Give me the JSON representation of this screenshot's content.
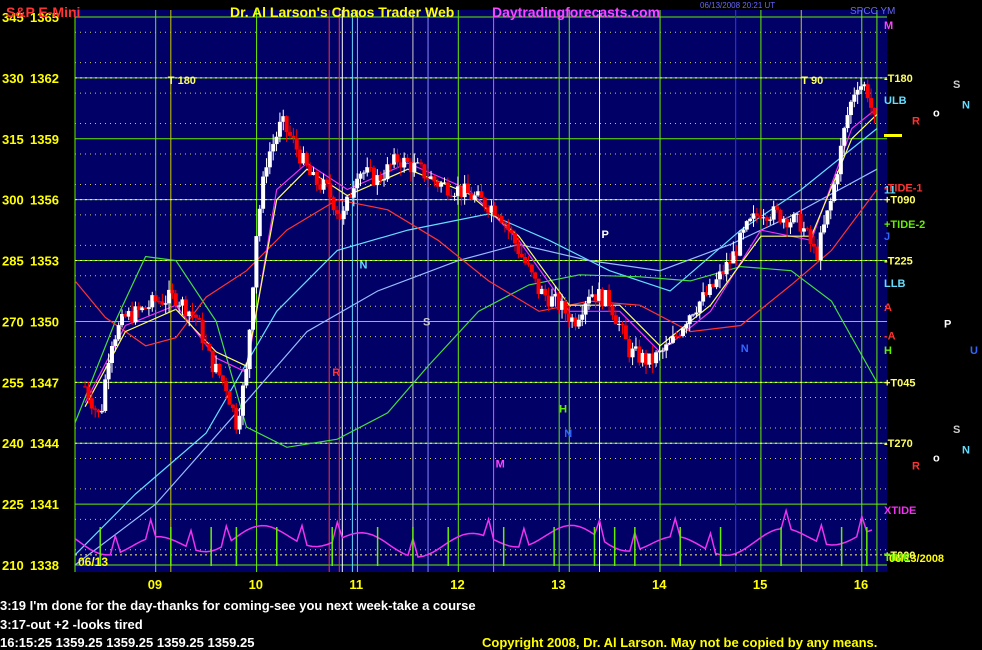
{
  "header": {
    "instrument": "S&P E-Mini",
    "site_title": "Dr. Al Larson's Chaos Trader Web",
    "url": "Daytradingforecasts.com",
    "timestamp": "06/13/2008 20:21 UT",
    "corner_label": "SPCC YM"
  },
  "colors": {
    "background": "#000066",
    "title": "#ffff00",
    "url": "#ff44ff",
    "green_grid": "#66ee00",
    "yellow_grid": "#ffff33",
    "white_candle": "#ffffff",
    "red_candle": "#ff0000",
    "cyan": "#66ddff",
    "magenta": "#ee33ee"
  },
  "footer": {
    "msg1": "3:19 I'm done for the day-thanks for coming-see you next week-take a course",
    "msg2": "3:17-out +2 -looks tired",
    "quote": "16:15:25  1359.25  1359.25  1359.25  1359.25",
    "copyright": "Copyright 2008, Dr. Al Larson. May not be copied by any means."
  },
  "chart_data": {
    "type": "candlestick",
    "title": "S&P E-Mini",
    "date_label": "06/13",
    "end_label": "06/13/2008",
    "x_ticks": [
      "09",
      "10",
      "11",
      "12",
      "13",
      "14",
      "15",
      "16"
    ],
    "x_range": [
      8.2,
      16.25
    ],
    "y_range": [
      1338,
      1365
    ],
    "y_labels": [
      {
        "left": "345",
        "price": "1365"
      },
      {
        "left": "330",
        "price": "1362"
      },
      {
        "left": "315",
        "price": "1359"
      },
      {
        "left": "300",
        "price": "1356"
      },
      {
        "left": "285",
        "price": "1353"
      },
      {
        "left": "270",
        "price": "1350"
      },
      {
        "left": "255",
        "price": "1347"
      },
      {
        "left": "240",
        "price": "1344"
      },
      {
        "left": "225",
        "price": "1341"
      },
      {
        "left": "210",
        "price": "1338"
      }
    ],
    "close_path": [
      [
        8.3,
        1346.8
      ],
      [
        8.45,
        1345.2
      ],
      [
        8.55,
        1349
      ],
      [
        8.7,
        1350.2
      ],
      [
        8.85,
        1350.5
      ],
      [
        9.0,
        1351.0
      ],
      [
        9.2,
        1351.2
      ],
      [
        9.4,
        1350.2
      ],
      [
        9.55,
        1348.0
      ],
      [
        9.7,
        1346.8
      ],
      [
        9.8,
        1345.0
      ],
      [
        9.9,
        1347.5
      ],
      [
        10.0,
        1354.5
      ],
      [
        10.1,
        1358.0
      ],
      [
        10.25,
        1359.8
      ],
      [
        10.4,
        1358.5
      ],
      [
        10.55,
        1357.0
      ],
      [
        10.7,
        1356.5
      ],
      [
        10.85,
        1355.0
      ],
      [
        11.0,
        1357.5
      ],
      [
        11.2,
        1357.0
      ],
      [
        11.4,
        1358.0
      ],
      [
        11.6,
        1357.5
      ],
      [
        11.8,
        1356.8
      ],
      [
        12.0,
        1356.5
      ],
      [
        12.2,
        1356.0
      ],
      [
        12.4,
        1355.5
      ],
      [
        12.6,
        1353.5
      ],
      [
        12.8,
        1351.5
      ],
      [
        13.0,
        1350.8
      ],
      [
        13.15,
        1350.0
      ],
      [
        13.3,
        1351.5
      ],
      [
        13.5,
        1351.0
      ],
      [
        13.7,
        1348.5
      ],
      [
        13.9,
        1348.0
      ],
      [
        14.1,
        1348.8
      ],
      [
        14.3,
        1350.5
      ],
      [
        14.5,
        1351.5
      ],
      [
        14.7,
        1353.0
      ],
      [
        14.85,
        1354.5
      ],
      [
        15.0,
        1355.5
      ],
      [
        15.2,
        1355.2
      ],
      [
        15.4,
        1354.8
      ],
      [
        15.55,
        1353.2
      ],
      [
        15.7,
        1356.0
      ],
      [
        15.85,
        1360.0
      ],
      [
        15.95,
        1361.8
      ],
      [
        16.05,
        1361.5
      ],
      [
        16.15,
        1359.25
      ]
    ],
    "moving_averages": [
      {
        "name": "",
        "color": "#66ddff",
        "points": [
          [
            8.2,
            1338.5
          ],
          [
            8.8,
            1341.5
          ],
          [
            9.5,
            1344.5
          ],
          [
            10.2,
            1350.5
          ],
          [
            10.8,
            1353.5
          ],
          [
            11.5,
            1354.5
          ],
          [
            12.3,
            1355.3
          ],
          [
            12.9,
            1354
          ],
          [
            13.5,
            1352.5
          ],
          [
            14.1,
            1351.5
          ],
          [
            14.8,
            1354.5
          ],
          [
            15.4,
            1356.5
          ],
          [
            15.9,
            1358.5
          ],
          [
            16.15,
            1359.5
          ]
        ]
      },
      {
        "name": "",
        "color": "#99bbff",
        "points": [
          [
            8.2,
            1338.0
          ],
          [
            9.0,
            1341.0
          ],
          [
            9.8,
            1345.5
          ],
          [
            10.5,
            1349.5
          ],
          [
            11.2,
            1351.5
          ],
          [
            12.0,
            1353.0
          ],
          [
            12.6,
            1353.8
          ],
          [
            13.3,
            1353.0
          ],
          [
            14.0,
            1352.5
          ],
          [
            14.7,
            1353.8
          ],
          [
            15.3,
            1355.2
          ],
          [
            16.15,
            1357.5
          ]
        ]
      },
      {
        "name": "",
        "color": "#44dd44",
        "points": [
          [
            8.2,
            1345.0
          ],
          [
            8.6,
            1350.0
          ],
          [
            8.9,
            1353.2
          ],
          [
            9.2,
            1353.0
          ],
          [
            9.6,
            1350.0
          ],
          [
            9.9,
            1344.8
          ],
          [
            10.3,
            1343.8
          ],
          [
            10.8,
            1344.2
          ],
          [
            11.3,
            1345.5
          ],
          [
            11.7,
            1347.8
          ],
          [
            12.2,
            1350.5
          ],
          [
            12.7,
            1351.8
          ],
          [
            13.2,
            1352.3
          ],
          [
            13.8,
            1352.2
          ],
          [
            14.3,
            1352.0
          ],
          [
            14.8,
            1352.7
          ],
          [
            15.3,
            1352.5
          ],
          [
            15.7,
            1351.0
          ],
          [
            16.15,
            1347.0
          ]
        ]
      },
      {
        "name": "",
        "color": "#ff3333",
        "points": [
          [
            8.2,
            1352.0
          ],
          [
            8.5,
            1350.2
          ],
          [
            8.9,
            1348.8
          ],
          [
            9.2,
            1349.2
          ],
          [
            9.5,
            1351.2
          ],
          [
            9.9,
            1352.5
          ],
          [
            10.3,
            1354.5
          ],
          [
            10.8,
            1356.0
          ],
          [
            11.3,
            1355.5
          ],
          [
            11.8,
            1354.0
          ],
          [
            12.3,
            1352.0
          ],
          [
            12.8,
            1350.5
          ],
          [
            13.3,
            1351.0
          ],
          [
            13.8,
            1350.8
          ],
          [
            14.3,
            1349.5
          ],
          [
            14.8,
            1349.8
          ],
          [
            15.3,
            1351.8
          ],
          [
            15.7,
            1353.5
          ],
          [
            16.15,
            1356.5
          ]
        ]
      },
      {
        "name": "",
        "color": "#ee33ee",
        "points": [
          [
            8.3,
            1346.0
          ],
          [
            8.7,
            1349.8
          ],
          [
            9.2,
            1350.8
          ],
          [
            9.6,
            1348.2
          ],
          [
            9.9,
            1347.5
          ],
          [
            10.2,
            1356.5
          ],
          [
            10.5,
            1357.8
          ],
          [
            10.9,
            1356.5
          ],
          [
            11.5,
            1357.8
          ],
          [
            12.1,
            1356.5
          ],
          [
            12.6,
            1354.0
          ],
          [
            13.1,
            1350.5
          ],
          [
            13.6,
            1350.5
          ],
          [
            14.0,
            1348.5
          ],
          [
            14.5,
            1350.5
          ],
          [
            15.0,
            1354.5
          ],
          [
            15.5,
            1354.0
          ],
          [
            15.9,
            1359.5
          ],
          [
            16.15,
            1360.5
          ]
        ]
      },
      {
        "name": "",
        "color": "#ffff66",
        "points": [
          [
            8.3,
            1345.8
          ],
          [
            8.7,
            1349.5
          ],
          [
            9.2,
            1350.6
          ],
          [
            9.6,
            1348.5
          ],
          [
            9.9,
            1347.8
          ],
          [
            10.2,
            1356.0
          ],
          [
            10.5,
            1357.5
          ],
          [
            10.9,
            1356.2
          ],
          [
            11.5,
            1357.5
          ],
          [
            12.1,
            1356.3
          ],
          [
            12.6,
            1354.2
          ],
          [
            13.1,
            1350.8
          ],
          [
            13.6,
            1350.8
          ],
          [
            14.0,
            1348.8
          ],
          [
            14.5,
            1350.8
          ],
          [
            15.0,
            1354.2
          ],
          [
            15.5,
            1354.2
          ],
          [
            15.9,
            1359.0
          ],
          [
            16.15,
            1360.2
          ]
        ]
      }
    ],
    "vertical_lines": [
      {
        "x": 9.15,
        "color": "#cccc00"
      },
      {
        "x": 10.72,
        "color": "#ff3333"
      },
      {
        "x": 10.82,
        "color": "#ff3333"
      },
      {
        "x": 10.95,
        "color": "#66ddff"
      },
      {
        "x": 10.85,
        "color": "#ffffff"
      },
      {
        "x": 11.55,
        "color": "#cccccc"
      },
      {
        "x": 11.7,
        "color": "#8888ff"
      },
      {
        "x": 12.35,
        "color": "#ff44ff"
      },
      {
        "x": 13.1,
        "color": "#66ee00"
      },
      {
        "x": 13.4,
        "color": "#ffffff"
      },
      {
        "x": 14.75,
        "color": "#3333ff"
      },
      {
        "x": 15.4,
        "color": "#cccc00"
      },
      {
        "x": 16.15,
        "color": "#66ee00"
      }
    ],
    "horizontal_levels": [
      {
        "price": 1362.0,
        "label": "-T180",
        "color": "#ffff66"
      },
      {
        "price": 1356.0,
        "label": "+T090",
        "color": "#ffff66"
      },
      {
        "price": 1353.0,
        "label": "-T225",
        "color": "#ffff66"
      },
      {
        "price": 1347.0,
        "label": "+T045",
        "color": "#ffff66"
      },
      {
        "price": 1344.0,
        "label": "-T270",
        "color": "#ffff66"
      },
      {
        "price": 1338.5,
        "label": "+T000",
        "color": "#ffff66"
      }
    ],
    "right_labels": [
      {
        "text": "M",
        "price": 1364.6,
        "color": "#ff44ff"
      },
      {
        "text": "ULB",
        "price": 1360.9,
        "color": "#66ddff"
      },
      {
        "text": "11",
        "price": 1356.5,
        "color": "#66ddff"
      },
      {
        "text": "-TIDE-1",
        "price": 1356.6,
        "color": "#ff3333"
      },
      {
        "text": "+TIDE-2",
        "price": 1354.8,
        "color": "#66ee00"
      },
      {
        "text": "J",
        "price": 1354.2,
        "color": "#3366ff"
      },
      {
        "text": "LLB",
        "price": 1351.9,
        "color": "#66ddff"
      },
      {
        "text": "A",
        "price": 1350.7,
        "color": "#ff3333"
      },
      {
        "text": "-A",
        "price": 1349.3,
        "color": "#ff3333"
      },
      {
        "text": "H",
        "price": 1348.6,
        "color": "#66ee00"
      },
      {
        "text": "XTIDE",
        "price": 1340.7,
        "color": "#ee33ee"
      },
      {
        "text": "TIME",
        "price": 1338.4,
        "color": "#66ee00"
      }
    ],
    "far_right_labels": [
      {
        "text": "S",
        "price": 1361.7,
        "color": "#cccccc",
        "x": 953
      },
      {
        "text": "N",
        "price": 1360.7,
        "color": "#66ddff",
        "x": 962
      },
      {
        "text": "R",
        "price": 1359.9,
        "color": "#ff3333",
        "x": 912
      },
      {
        "text": "o",
        "price": 1360.3,
        "color": "#ffffff",
        "x": 933
      },
      {
        "text": "P",
        "price": 1349.9,
        "color": "#ffffff",
        "x": 944
      },
      {
        "text": "U",
        "price": 1348.6,
        "color": "#3366ff",
        "x": 970
      },
      {
        "text": "S",
        "price": 1344.7,
        "color": "#cccccc",
        "x": 953
      },
      {
        "text": "N",
        "price": 1343.7,
        "color": "#66ddff",
        "x": 962
      },
      {
        "text": "R",
        "price": 1342.9,
        "color": "#ff3333",
        "x": 912
      },
      {
        "text": "o",
        "price": 1343.3,
        "color": "#ffffff",
        "x": 933
      }
    ],
    "annotations": [
      {
        "text": "T 180",
        "x": 9.12,
        "price": 1361.9,
        "color": "#ffff66"
      },
      {
        "text": "T 90",
        "x": 15.4,
        "price": 1361.9,
        "color": "#ffff66"
      },
      {
        "text": "N",
        "x": 11.02,
        "price": 1352.8,
        "color": "#66ddff"
      },
      {
        "text": "S",
        "x": 11.65,
        "price": 1350.0,
        "color": "#cccccc"
      },
      {
        "text": "R",
        "x": 10.75,
        "price": 1347.5,
        "color": "#ff3333"
      },
      {
        "text": "P",
        "x": 13.42,
        "price": 1354.3,
        "color": "#ffffff"
      },
      {
        "text": "H",
        "x": 13.0,
        "price": 1345.7,
        "color": "#66ee00"
      },
      {
        "text": "N",
        "x": 13.05,
        "price": 1344.5,
        "color": "#3366ff"
      },
      {
        "text": "M",
        "x": 12.37,
        "price": 1343.0,
        "color": "#ff44ff"
      },
      {
        "text": "N",
        "x": 14.8,
        "price": 1348.7,
        "color": "#3366ff"
      }
    ]
  }
}
